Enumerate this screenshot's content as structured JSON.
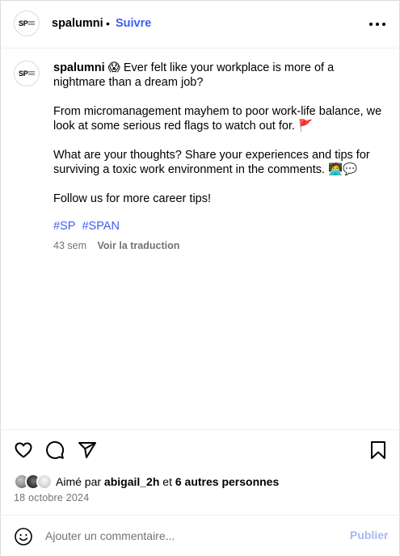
{
  "header": {
    "avatar_text": "SP",
    "username": "spalumni",
    "separator": "•",
    "follow_label": "Suivre",
    "more_icon": "more-horizontal-icon"
  },
  "caption": {
    "username": "spalumni",
    "line1_emoji": "😱",
    "line1_text": "Ever felt like your workplace is more of a nightmare than a dream job?",
    "para2_text": "From micromanagement mayhem to poor work-life balance, we look at some serious red flags to watch out for.",
    "para2_emoji": "🚩",
    "para3_text": "What are your thoughts? Share your experiences and tips for surviving a toxic work environment in the comments.",
    "para3_emoji": "🧑‍💻💬",
    "para4_text": "Follow us for more career tips!",
    "hashtags": [
      "#SP",
      "#SPAN"
    ],
    "time": "43 sem",
    "translate_label": "Voir la traduction"
  },
  "actions": {
    "icons": [
      "heart-icon",
      "comment-icon",
      "share-icon",
      "bookmark-icon"
    ]
  },
  "likes": {
    "prefix": "Aimé par",
    "user": "abigail_2h",
    "connector": "et",
    "others": "6 autres personnes"
  },
  "date": "18 octobre 2024",
  "comment_box": {
    "placeholder": "Ajouter un commentaire...",
    "value": "",
    "publish_label": "Publier"
  },
  "colors": {
    "accent": "#3f5ef0",
    "muted": "#737373",
    "publish_disabled": "#a5b8f5",
    "border": "#dbdbdb"
  }
}
